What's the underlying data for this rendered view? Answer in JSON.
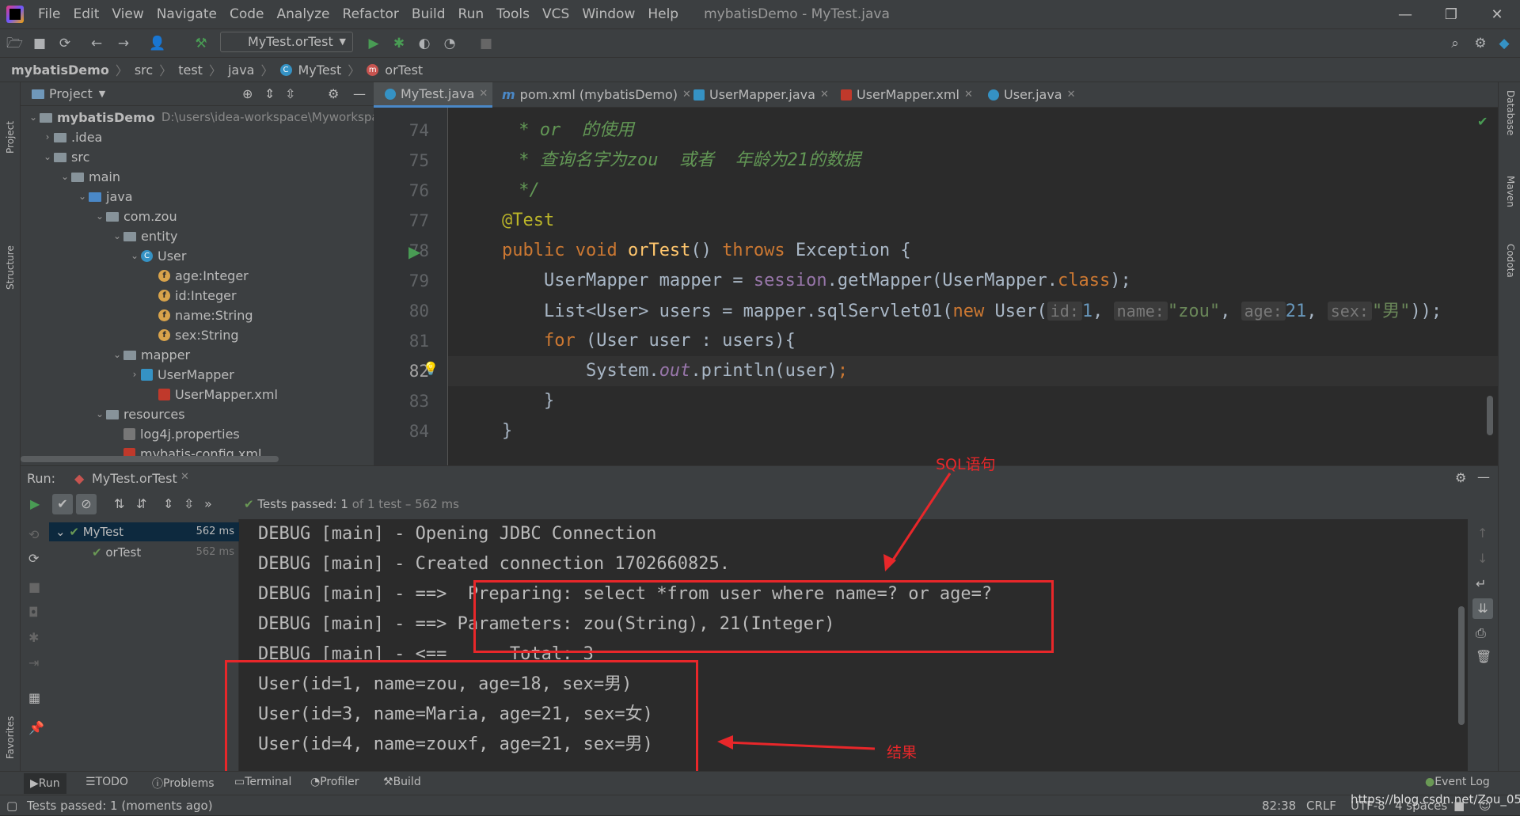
{
  "menu": {
    "items": [
      "File",
      "Edit",
      "View",
      "Navigate",
      "Code",
      "Analyze",
      "Refactor",
      "Build",
      "Run",
      "Tools",
      "VCS",
      "Window",
      "Help"
    ],
    "window_title": "mybatisDemo - MyTest.java"
  },
  "toolbar": {
    "run_config": "MyTest.orTest"
  },
  "breadcrumb": [
    "mybatisDemo",
    "src",
    "test",
    "java",
    "MyTest",
    "orTest"
  ],
  "side_left": {
    "project": "Project",
    "structure": "Structure",
    "favorites": "Favorites"
  },
  "side_right": {
    "database": "Database",
    "maven": "Maven",
    "codota": "Codota"
  },
  "project_panel": {
    "title": "Project",
    "tree": {
      "root": "mybatisDemo",
      "root_path": "D:\\users\\idea-workspace\\Myworkspace",
      "idea": ".idea",
      "src": "src",
      "main": "main",
      "java": "java",
      "pkg": "com.zou",
      "entity": "entity",
      "user_class": "User",
      "f1": "age:Integer",
      "f2": "id:Integer",
      "f3": "name:String",
      "f4": "sex:String",
      "mapper": "mapper",
      "mapper_iface": "UserMapper",
      "mapper_xml": "UserMapper.xml",
      "resources": "resources",
      "log4j": "log4j.properties",
      "mybatis_cfg": "mybatis-config.xml"
    }
  },
  "editor_tabs": [
    "MyTest.java",
    "pom.xml (mybatisDemo)",
    "UserMapper.java",
    "UserMapper.xml",
    "User.java"
  ],
  "code": {
    "line_numbers": [
      "74",
      "75",
      "76",
      "77",
      "78",
      "79",
      "80",
      "81",
      "82",
      "83",
      "84"
    ],
    "l74": " * or  的使用",
    "l75": " * 查询名字为zou  或者  年龄为21的数据",
    "l76": " */",
    "l77": "@Test",
    "l78_a": "public void ",
    "l78_b": "orTest",
    "l78_c": "() ",
    "l78_d": "throws ",
    "l78_e": "Exception {",
    "l79_a": "    UserMapper mapper = ",
    "l79_b": "session",
    "l79_c": ".getMapper(UserMapper.",
    "l79_d": "class",
    "l79_e": ");",
    "l80_a": "    List<User> users = mapper.sqlServlet01(",
    "l80_b": "new ",
    "l80_c": "User(",
    "l80_h1": "id:",
    "l80_v1": "1",
    "l80_h2": "name:",
    "l80_v2": "\"zou\"",
    "l80_h3": "age:",
    "l80_v3": "21",
    "l80_h4": "sex:",
    "l80_v4": "\"男\"",
    "l80_end": "));",
    "l81_a": "    for ",
    "l81_b": "(User user : users){",
    "l82_a": "        System.",
    "l82_b": "out",
    "l82_c": ".println(user)",
    "l82_d": ";",
    "l83": "    }",
    "l84": "}"
  },
  "run": {
    "label": "Run:",
    "tab": "MyTest.orTest",
    "status_prefix": "Tests passed:",
    "status_count": "1",
    "status_suffix": "of 1 test – 562 ms",
    "tree": [
      {
        "name": "MyTest",
        "time": "562 ms"
      },
      {
        "name": "orTest",
        "time": "562 ms"
      }
    ],
    "console": [
      "DEBUG [main] - Opening JDBC Connection",
      "DEBUG [main] - Created connection 1702660825.",
      "DEBUG [main] - ==>  Preparing: select *from user where name=? or age=?",
      "DEBUG [main] - ==> Parameters: zou(String), 21(Integer)",
      "DEBUG [main] - <==      Total: 3",
      "User(id=1, name=zou, age=18, sex=男)",
      "User(id=3, name=Maria, age=21, sex=女)",
      "User(id=4, name=zouxf, age=21, sex=男)"
    ]
  },
  "annotations": {
    "sql": "SQL语句",
    "result": "结果"
  },
  "bottom_tabs": [
    "Run",
    "TODO",
    "Problems",
    "Terminal",
    "Profiler",
    "Build"
  ],
  "event_log": "Event Log",
  "status": {
    "message": "Tests passed: 1 (moments ago)",
    "pos": "82:38",
    "eol": "CRLF",
    "enc": "UTF-8",
    "indent": "4 spaces",
    "watermark": "https://blog.csdn.net/Zou_05"
  },
  "colors": {
    "accent": "#4a88c7",
    "annotation": "#e8272a",
    "pass": "#499c54"
  }
}
